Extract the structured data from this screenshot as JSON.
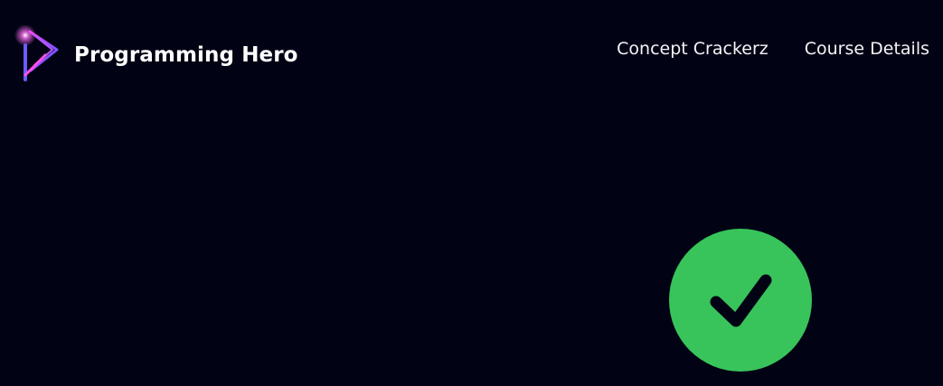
{
  "header": {
    "brand_name": "Programming Hero",
    "logo_icon": "play-logo-icon",
    "nav_links": [
      {
        "label": "Concept Crackerz"
      },
      {
        "label": "Course Details"
      }
    ]
  },
  "status": {
    "icon": "check-circle-icon",
    "success_color": "#38c45a",
    "background_color": "#010314"
  }
}
